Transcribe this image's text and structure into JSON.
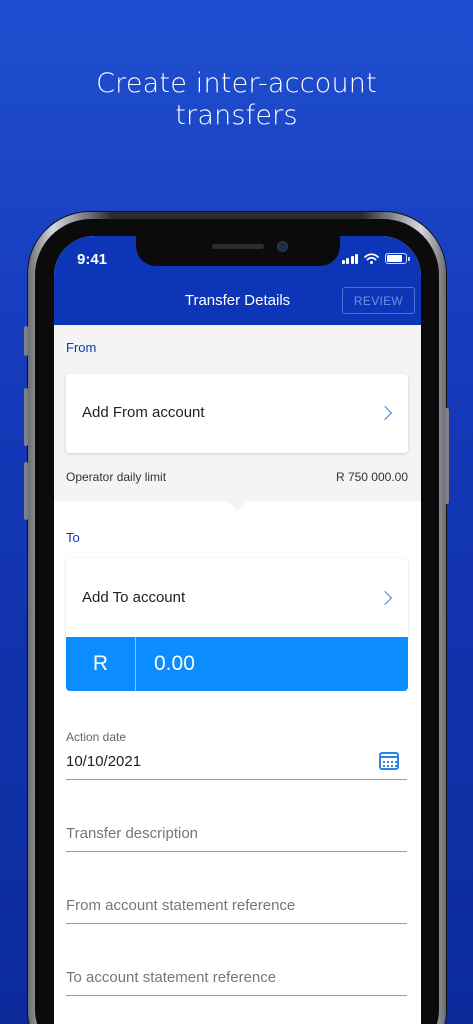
{
  "headline": {
    "line1": "Create inter-account",
    "line2": "transfers"
  },
  "status_bar": {
    "time": "9:41"
  },
  "navbar": {
    "title": "Transfer Details",
    "review_label": "REVIEW"
  },
  "from": {
    "label": "From",
    "add_account": "Add From account",
    "limit_label": "Operator daily limit",
    "limit_value": "R 750 000.00"
  },
  "to": {
    "label": "To",
    "add_account": "Add To account"
  },
  "amount": {
    "currency": "R",
    "value": "0.00"
  },
  "fields": {
    "action_date_label": "Action date",
    "action_date_value": "10/10/2021",
    "transfer_description": "Transfer description",
    "from_reference": "From account statement reference",
    "to_reference": "To account statement reference"
  },
  "colors": {
    "brand": "#0c36b7",
    "accent": "#0b8cff"
  }
}
